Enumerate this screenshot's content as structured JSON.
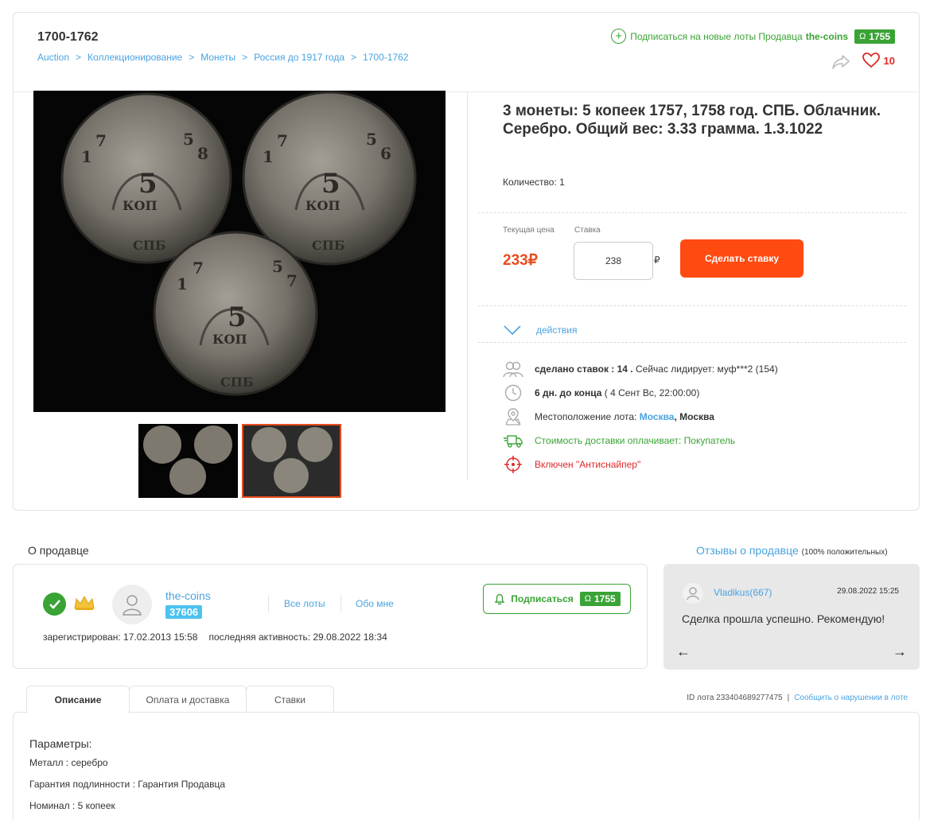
{
  "header": {
    "category_title": "1700-1762",
    "breadcrumb": [
      "Auction",
      "Коллекционирование",
      "Монеты",
      "Россия до 1917 года",
      "1700-1762"
    ],
    "breadcrumb_sep": ">",
    "subscribe_text": "Подписаться на новые лоты Продавца",
    "seller_name": "the-coins",
    "seller_score": "1755",
    "favorites_count": "10"
  },
  "lot": {
    "title": "3 монеты: 5 копеек 1757, 1758 год. СПБ. Облачник. Серебро. Общий вес: 3.33 грамма. 1.3.1022",
    "quantity": "Количество: 1",
    "current_price_label": "Текущая цена",
    "bid_label": "Ставка",
    "current_price": "233₽",
    "bid_value": "238",
    "currency": "₽",
    "bid_button": "Сделать ставку",
    "actions_label": "действия",
    "bids_made": "сделано ставок : 14 .",
    "leader_text": "Сейчас лидирует: муф***2 (154)",
    "time_left": "6 дн. до конца",
    "end_time": "( 4 Сент Вс, 22:00:00)",
    "location_label": "Местоположение лота:",
    "location_city": "Москва",
    "location_region": ", Москва",
    "delivery": "Стоимость доставки оплачивает: Покупатель",
    "antisniper": "Включен \"Антиснайпер\""
  },
  "seller": {
    "heading": "О продавце",
    "name": "the-coins",
    "rating": "37606",
    "all_lots": "Все лоты",
    "about_me": "Обо мне",
    "subscribe": "Подписаться",
    "score": "1755",
    "registered": "зарегистрирован: 17.02.2013 15:58",
    "last_activity": "последняя активность: 29.08.2022 18:34"
  },
  "reviews": {
    "heading": "Отзывы о продавце",
    "heading_note": "(100% положительных)",
    "user": "Vladikus(667)",
    "date": "29.08.2022 15:25",
    "text": "Сделка прошла успешно. Рекомендую!"
  },
  "tabs": [
    {
      "label": "Описание"
    },
    {
      "label": "Оплата и доставка"
    },
    {
      "label": "Ставки"
    }
  ],
  "lot_id_text": "ID лота 233404689277475",
  "report_link": "Сообщить о нарушении в лоте",
  "description": {
    "params_title": "Параметры:",
    "params": [
      "Металл : серебро",
      "Гарантия подлинности : Гарантия Продавца",
      "Номинал : 5 копеек"
    ]
  },
  "colors": {
    "accent_orange": "#ff4a11",
    "price_red": "#e94c1f",
    "green": "#3aa335",
    "link_blue": "#4aa3df"
  }
}
